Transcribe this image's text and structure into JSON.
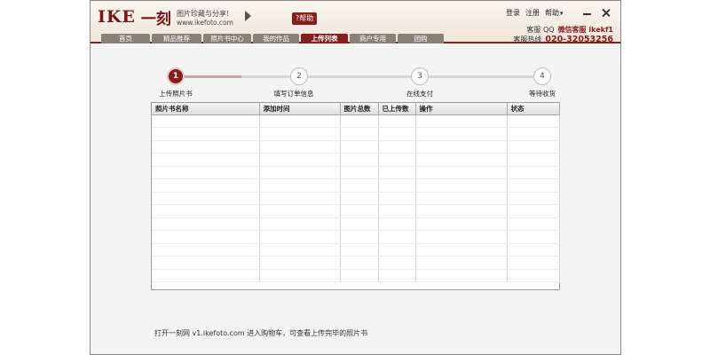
{
  "header": {
    "logo_text": "IKE",
    "logo_cn": "一刻",
    "tagline": "图片珍藏与分享!",
    "site": "www.ikefoto.com",
    "help_button": "?帮助"
  },
  "top_links": {
    "login": "登录",
    "register": "注册",
    "help_menu": "帮助"
  },
  "service": {
    "qq_label": "客服 QQ",
    "qq_value": "微信客服 ikekf1",
    "hotline_label": "客服热线",
    "hotline_value": "020-32053256"
  },
  "tabs": [
    {
      "label": "首页"
    },
    {
      "label": "精品推荐"
    },
    {
      "label": "照片书中心"
    },
    {
      "label": "我的作品"
    },
    {
      "label": "上传列表"
    },
    {
      "label": "商户专用"
    },
    {
      "label": "团购"
    }
  ],
  "active_tab": "上传列表",
  "steps": [
    {
      "number": "1",
      "label": "上传照片书"
    },
    {
      "number": "2",
      "label": "填写订单信息"
    },
    {
      "number": "3",
      "label": "在线支付"
    },
    {
      "number": "4",
      "label": "等待收货"
    }
  ],
  "current_step": 1,
  "table": {
    "columns": [
      "照片书名称",
      "添加时间",
      "图片总数",
      "已上传数",
      "操作",
      "状态"
    ],
    "rows": []
  },
  "footer_note": "打开一刻网 v1.ikefoto.com 进入购物车，可查看上传完毕的照片书",
  "colors": {
    "accent": "#8b1c1c",
    "tab_inactive": "#8a8077"
  }
}
